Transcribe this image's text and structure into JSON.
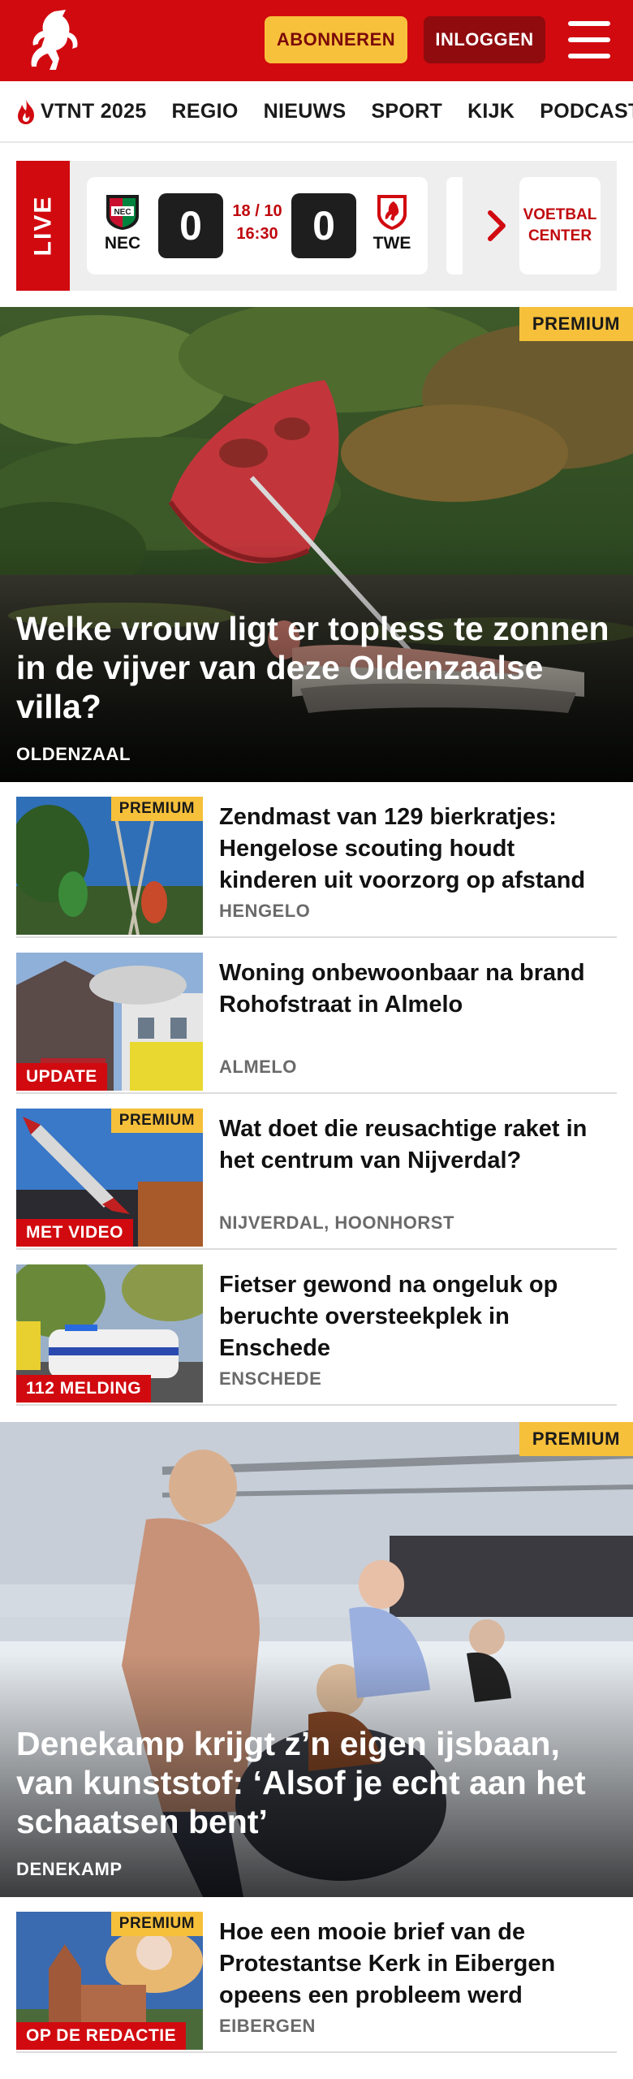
{
  "header": {
    "subscribe_label": "ABONNEREN",
    "login_label": "INLOGGEN"
  },
  "nav": {
    "items": [
      "VTNT 2025",
      "REGIO",
      "NIEUWS",
      "SPORT",
      "KIJK",
      "PODCAST"
    ]
  },
  "live": {
    "badge": "LIVE",
    "match": {
      "home": "NEC",
      "away": "TWE",
      "home_score": "0",
      "away_score": "0",
      "date": "18 / 10",
      "time": "16:30"
    },
    "football_center": "VOETBAL CENTER"
  },
  "hero": {
    "tag": "PREMIUM",
    "title": "Welke vrouw ligt er topless te zonnen in de vijver van deze Oldenzaalse villa?",
    "location": "OLDENZAAL"
  },
  "articles": [
    {
      "title": "Zendmast van 129 bierkratjes: Hengelose scouting houdt kinderen uit voorzorg op afstand",
      "location": "HENGELO",
      "premium": "PREMIUM",
      "label": ""
    },
    {
      "title": "Woning onbewoonbaar na brand Rohofstraat in Almelo",
      "location": "ALMELO",
      "premium": "",
      "label": "UPDATE"
    },
    {
      "title": "Wat doet die reusachtige raket in het centrum van Nijverdal?",
      "location": "NIJVERDAL, HOONHORST",
      "premium": "PREMIUM",
      "label": "MET VIDEO"
    },
    {
      "title": "Fietser gewond na ongeluk op beruchte oversteekplek in Enschede",
      "location": "ENSCHEDE",
      "premium": "",
      "label": "112 MELDING"
    }
  ],
  "hero2": {
    "tag": "PREMIUM",
    "title": "Denekamp krijgt z’n eigen ijsbaan, van kunststof: ‘Alsof je echt aan het schaatsen bent’",
    "location": "DENEKAMP"
  },
  "articles2": [
    {
      "title": "Hoe een mooie brief van de Protestantse Kerk in Eibergen opeens een probleem werd",
      "location": "EIBERGEN",
      "premium": "PREMIUM",
      "label": "OP DE REDACTIE"
    }
  ],
  "colors": {
    "brand_red": "#d10a10",
    "premium_yellow": "#f6c03b",
    "dark_red": "#8f0b0e"
  }
}
